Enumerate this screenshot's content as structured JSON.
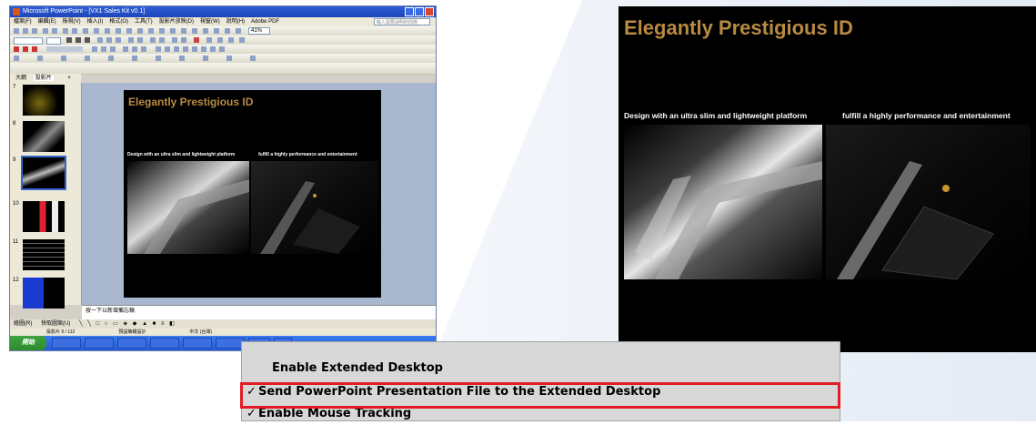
{
  "ppt_window": {
    "title": "Microsoft PowerPoint - [VX1 Sales Kit v0.1]",
    "menus": [
      "檔案(F)",
      "編輯(E)",
      "檢視(V)",
      "插入(I)",
      "格式(O)",
      "工具(T)",
      "投影片放映(D)",
      "視窗(W)",
      "說明(H)",
      "Adobe PDF"
    ],
    "help_placeholder": "輸入需要說明的問題",
    "zoom": "41%",
    "pane_tabs": [
      "大綱",
      "投影片"
    ],
    "thumb_numbers": [
      "7",
      "8",
      "9",
      "10",
      "11",
      "12"
    ],
    "selected_thumb": "9",
    "notes_placeholder": "按一下以新增備忘稿",
    "draw_label": "繪圖(R)",
    "autoshape_label": "快取圖案(U)",
    "status_slide": "投影片 9 / 112",
    "status_template": "預設簡報設計",
    "status_language": "中文 (台灣)",
    "start_label": "開始"
  },
  "slide": {
    "title": "Elegantly Prestigious ID",
    "caption_left": "Design with an ultra slim and lightweight platform",
    "caption_right": "fulfill a highly performance and entertainment"
  },
  "context_menu": {
    "items": [
      {
        "label": "Enable Extended Desktop",
        "checked": false
      },
      {
        "label": "Send PowerPoint Presentation File to the Extended Desktop",
        "checked": true
      },
      {
        "label": "Enable Mouse Tracking",
        "checked": true
      }
    ],
    "check_glyph": "✓",
    "highlight_color": "#e21c24"
  },
  "colors": {
    "title_text": "#b88a42",
    "slide_bg": "#000000",
    "xp_blue": "#245ad6"
  }
}
